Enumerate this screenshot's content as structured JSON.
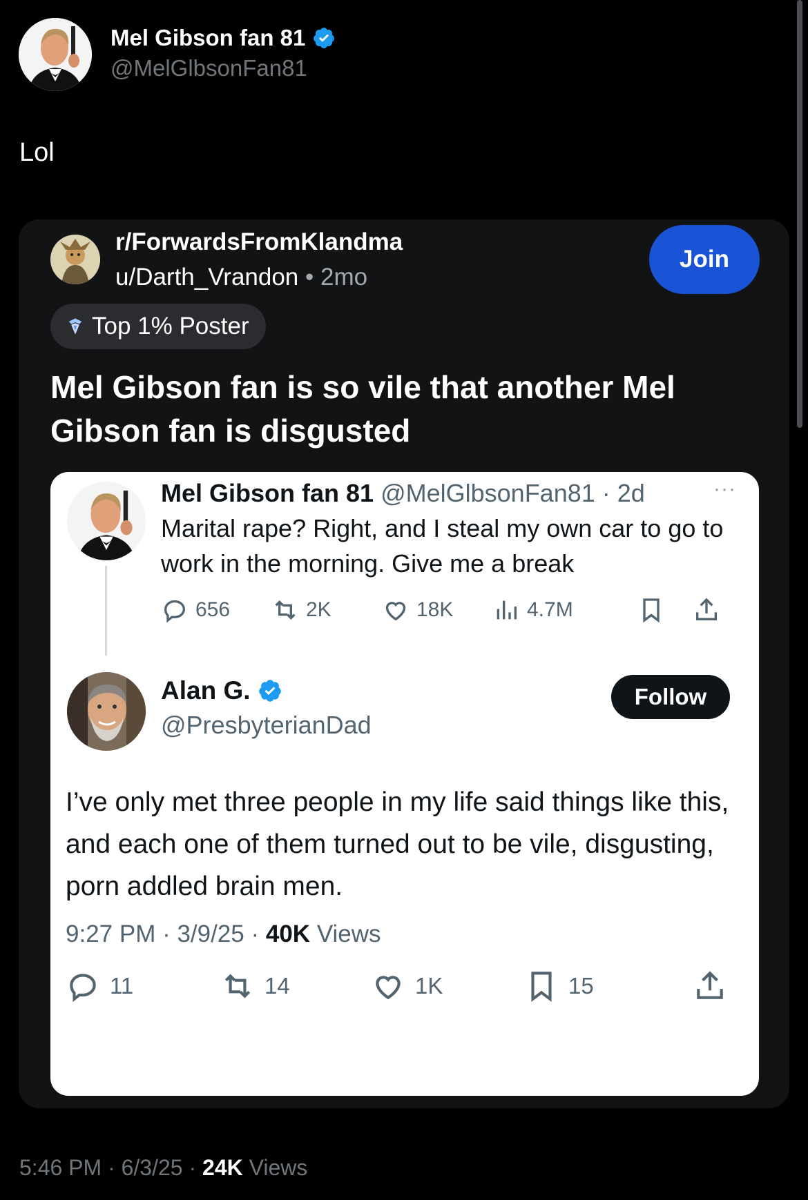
{
  "author": {
    "display_name": "Mel Gibson fan 81",
    "handle": "@MelGlbsonFan81",
    "verified_icon": "verified-badge-icon",
    "avatar_icon": "avatar"
  },
  "tweet": {
    "text": "Lol"
  },
  "reddit_post": {
    "subreddit": "r/ForwardsFromKlandma",
    "user": "u/Darth_Vrandon",
    "separator": "•",
    "age": "2mo",
    "join_label": "Join",
    "flair": "Top 1% Poster",
    "title": "Mel Gibson fan is so vile that another Mel Gibson fan is disgusted",
    "accent_color": "#1a54d6"
  },
  "screenshot": {
    "quoted": {
      "name": "Mel Gibson fan 81",
      "handle_time": "@MelGlbsonFan81 · 2d",
      "more": "···",
      "text": "Marital rape? Right, and I steal my own car to go to work in the morning. Give me a break",
      "replies": "656",
      "reposts": "2K",
      "likes": "18K",
      "views": "4.7M"
    },
    "reply": {
      "name": "Alan G.",
      "handle": "@PresbyterianDad",
      "follow_label": "Follow",
      "text": "I’ve only met three people in my life said things like this, and each one of them turned out to be vile, disgusting, porn addled brain men.",
      "time": "9:27 PM · 3/9/25 · ",
      "views_count": "40K",
      "views_label": " Views",
      "replies": "11",
      "reposts": "14",
      "likes": "1K",
      "bookmarks": "15"
    }
  },
  "footer": {
    "time": "5:46 PM · 6/3/25 · ",
    "views_count": "24K",
    "views_label": " Views"
  }
}
